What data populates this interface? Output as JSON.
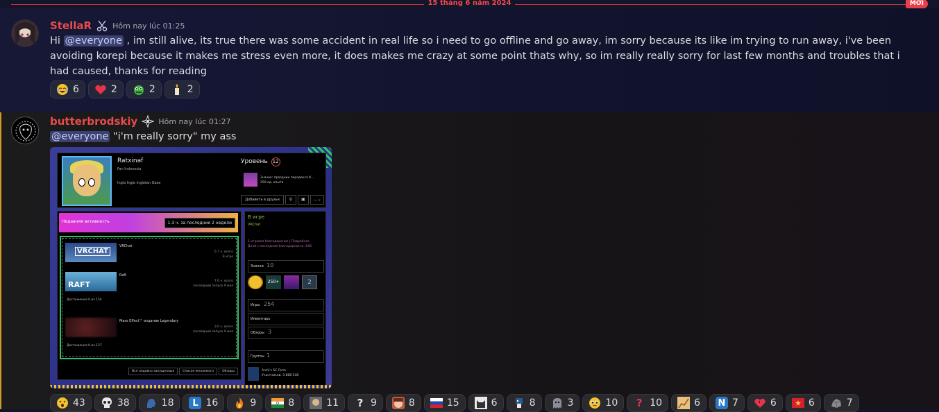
{
  "divider": {
    "date": "15 tháng 6 năm 2024",
    "new_label": "MỚI"
  },
  "messages": [
    {
      "username": "StellaR",
      "role_icon": "scissors-icon",
      "timestamp": "Hôm nay lúc 01:25",
      "text_prefix": "Hi ",
      "mention": "@everyone",
      "text_body": " , im still alive, its true there was some accident in real life so i need to go offline and go away, im sorry because its like im trying to run away, i've been avoiding korepi because it makes me stress even more, it does makes me crazy at some point thats why, so im really really sorry for last  few months and troubles that i had caused, thanks for reading",
      "reactions": [
        {
          "emoji": "crying-laughing-icon",
          "count": "6"
        },
        {
          "emoji": "heart-icon",
          "count": "2"
        },
        {
          "emoji": "green-monster-icon",
          "count": "2"
        },
        {
          "emoji": "candle-icon",
          "count": "2"
        }
      ]
    },
    {
      "username": "butterbrodskiy",
      "role_icon": "sparkle-badge-icon",
      "timestamp": "Hôm nay lúc 01:27",
      "mention": "@everyone",
      "text_body": " \"i'm really sorry\" my ass",
      "reactions": [
        {
          "emoji": "astonished-face-icon",
          "count": "43"
        },
        {
          "emoji": "skull-icon",
          "count": "38"
        },
        {
          "emoji": "talking-head-icon",
          "count": "18"
        },
        {
          "emoji": "letter-l-icon",
          "count": "16"
        },
        {
          "emoji": "fire-icon",
          "count": "9"
        },
        {
          "emoji": "india-flag-icon",
          "count": "8"
        },
        {
          "emoji": "meme-face-icon",
          "count": "11"
        },
        {
          "emoji": "question-mark-icon",
          "count": "9"
        },
        {
          "emoji": "anime-face-icon",
          "count": "8"
        },
        {
          "emoji": "russia-flag-icon",
          "count": "15"
        },
        {
          "emoji": "cat-meme-icon",
          "count": "6"
        },
        {
          "emoji": "pixel-character-icon",
          "count": "8"
        },
        {
          "emoji": "ghost-icon",
          "count": "3"
        },
        {
          "emoji": "pleading-face-icon",
          "count": "10"
        },
        {
          "emoji": "red-question-icon",
          "count": "10"
        },
        {
          "emoji": "chart-meme-icon",
          "count": "6"
        },
        {
          "emoji": "letter-n-icon",
          "count": "7"
        },
        {
          "emoji": "broken-heart-icon",
          "count": "6"
        },
        {
          "emoji": "vietnam-flag-icon",
          "count": "6"
        },
        {
          "emoji": "rock-icon",
          "count": "7"
        }
      ]
    }
  ],
  "steam_profile": {
    "name": "Ratxinaf",
    "subtitle": "Fan  Indonesia",
    "quote": "Inglo Inglo Inglotan Gaes",
    "level_label": "Уровень",
    "level": "12",
    "badge_name": "Значок: праздник парадокса К...",
    "badge_xp": "250 ед. опыта",
    "add_friend": "Добавить в друзья",
    "activity_title": "Недавняя активность",
    "activity_hours": "1.3 ч. за последние 2 недели",
    "games": [
      {
        "name": "VRChat",
        "stat1": "6.7 ч. всего",
        "stat2": "В игре",
        "achievements": ""
      },
      {
        "name": "Raft",
        "stat1": "7.6 ч. всего",
        "stat2": "последний запуск 9 мая",
        "achievements": "Достижения  0 из 154"
      },
      {
        "name": "Mass Effect™ издание Legendary",
        "stat1": "3.0 ч. всего",
        "stat2": "последний запуск 9 мая",
        "achievements": "Достижения  0 из 127"
      }
    ],
    "links": [
      "Все недавно запущенные",
      "Список желаемого",
      "Обзоры"
    ],
    "status": "В игре",
    "status_game": "VRChat",
    "note_line1": "1 игровое благодарение | Подробнее",
    "note_line2": "Дней с последней благодарности: 646",
    "badges_label": "Значки",
    "badges_count": "10",
    "games_label": "Игры",
    "games_count": "254",
    "inventory_label": "Инвентарь",
    "reviews_label": "Обзоры",
    "reviews_count": "3",
    "groups_label": "Группы",
    "groups_count": "1",
    "group_name": "Archi's SC Farm",
    "group_members": "Участников: 3 888 348"
  }
}
